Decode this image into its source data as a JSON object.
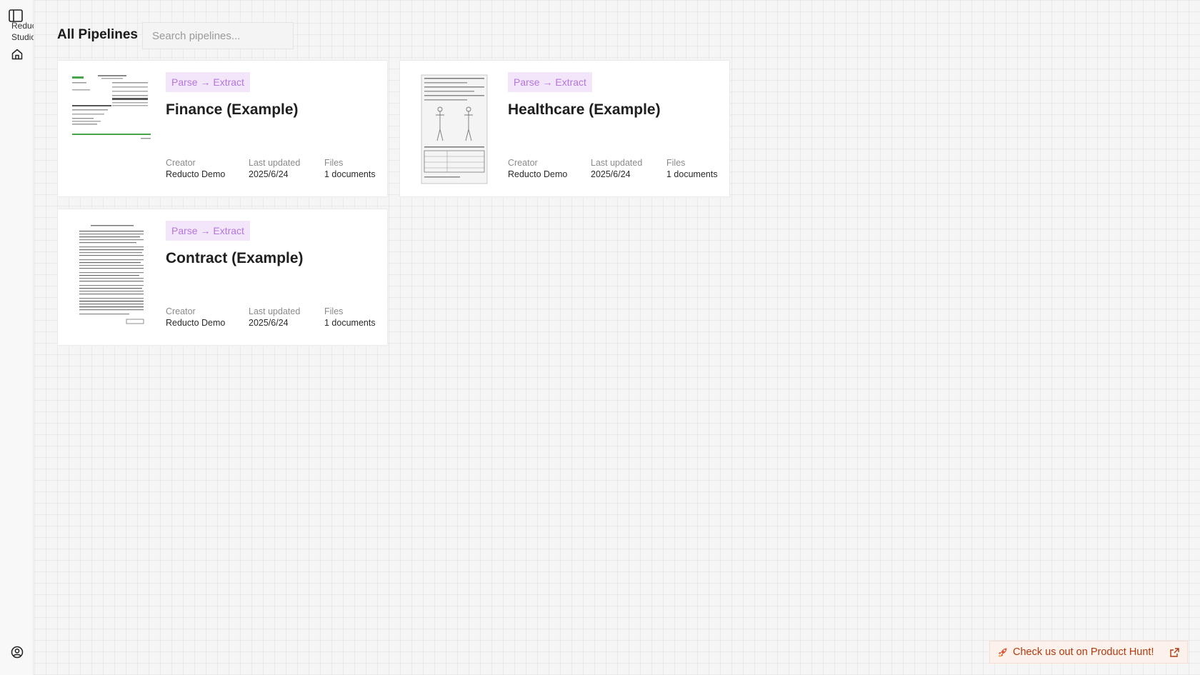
{
  "sidebar": {
    "brand_line1": "Reducto",
    "brand_line2": "Studio",
    "toggle_icon": "sidebar-toggle-icon",
    "home_icon": "home-icon",
    "account_icon": "user-circle-icon"
  },
  "header": {
    "title": "All Pipelines",
    "search_placeholder": "Search pipelines..."
  },
  "pipelines": [
    {
      "badge": "Parse → Extract",
      "title": "Finance (Example)",
      "creator_label": "Creator",
      "creator": "Reducto Demo",
      "updated_label": "Last updated",
      "updated": "2025/6/24",
      "files_label": "Files",
      "files": "1 documents"
    },
    {
      "badge": "Parse → Extract",
      "title": "Healthcare (Example)",
      "creator_label": "Creator",
      "creator": "Reducto Demo",
      "updated_label": "Last updated",
      "updated": "2025/6/24",
      "files_label": "Files",
      "files": "1 documents"
    },
    {
      "badge": "Parse → Extract",
      "title": "Contract (Example)",
      "creator_label": "Creator",
      "creator": "Reducto Demo",
      "updated_label": "Last updated",
      "updated": "2025/6/24",
      "files_label": "Files",
      "files": "1 documents"
    }
  ],
  "banner": {
    "text": "Check us out on Product Hunt!",
    "rocket_icon": "rocket-icon",
    "external_icon": "external-link-icon"
  },
  "colors": {
    "badge_bg": "#f3e6fb",
    "badge_text": "#b476d8",
    "banner_text": "#b03a10"
  }
}
